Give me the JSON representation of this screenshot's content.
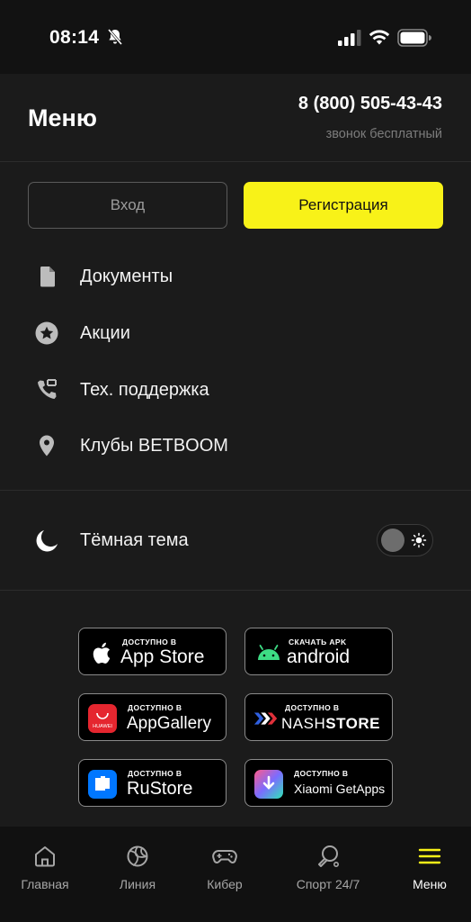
{
  "status_bar": {
    "time": "08:14"
  },
  "header": {
    "title": "Меню",
    "phone": "8 (800) 505-43-43",
    "phone_note": "звонок бесплатный"
  },
  "auth": {
    "login_label": "Вход",
    "register_label": "Регистрация"
  },
  "menu": {
    "items": [
      {
        "label": "Документы",
        "icon": "document-icon"
      },
      {
        "label": "Акции",
        "icon": "star-badge-icon"
      },
      {
        "label": "Тех. поддержка",
        "icon": "phone-support-icon"
      },
      {
        "label": "Клубы BETBOOM",
        "icon": "location-pin-icon"
      }
    ]
  },
  "theme": {
    "label": "Тёмная тема",
    "icon": "moon-icon"
  },
  "stores": [
    {
      "small": "ДОСТУПНО В",
      "big": "App Store"
    },
    {
      "small": "СКАЧАТЬ APK",
      "big": "android"
    },
    {
      "small": "ДОСТУПНО В",
      "big": "AppGallery",
      "logo_text": "HUAWEI"
    },
    {
      "small": "ДОСТУПНО В",
      "big_a": "NASH",
      "big_b": "STORE"
    },
    {
      "small": "ДОСТУПНО В",
      "big": "RuStore"
    },
    {
      "small": "ДОСТУПНО В",
      "big": "Xiaomi GetApps"
    }
  ],
  "tabs": [
    {
      "label": "Главная",
      "icon": "home-icon"
    },
    {
      "label": "Линия",
      "icon": "ball-icon"
    },
    {
      "label": "Кибер",
      "icon": "gamepad-icon"
    },
    {
      "label": "Спорт 24/7",
      "icon": "ping-pong-icon"
    },
    {
      "label": "Меню",
      "icon": "hamburger-menu-icon"
    }
  ],
  "colors": {
    "accent": "#f8f218",
    "background": "#1b1b1b",
    "tab_bar": "#111111"
  }
}
